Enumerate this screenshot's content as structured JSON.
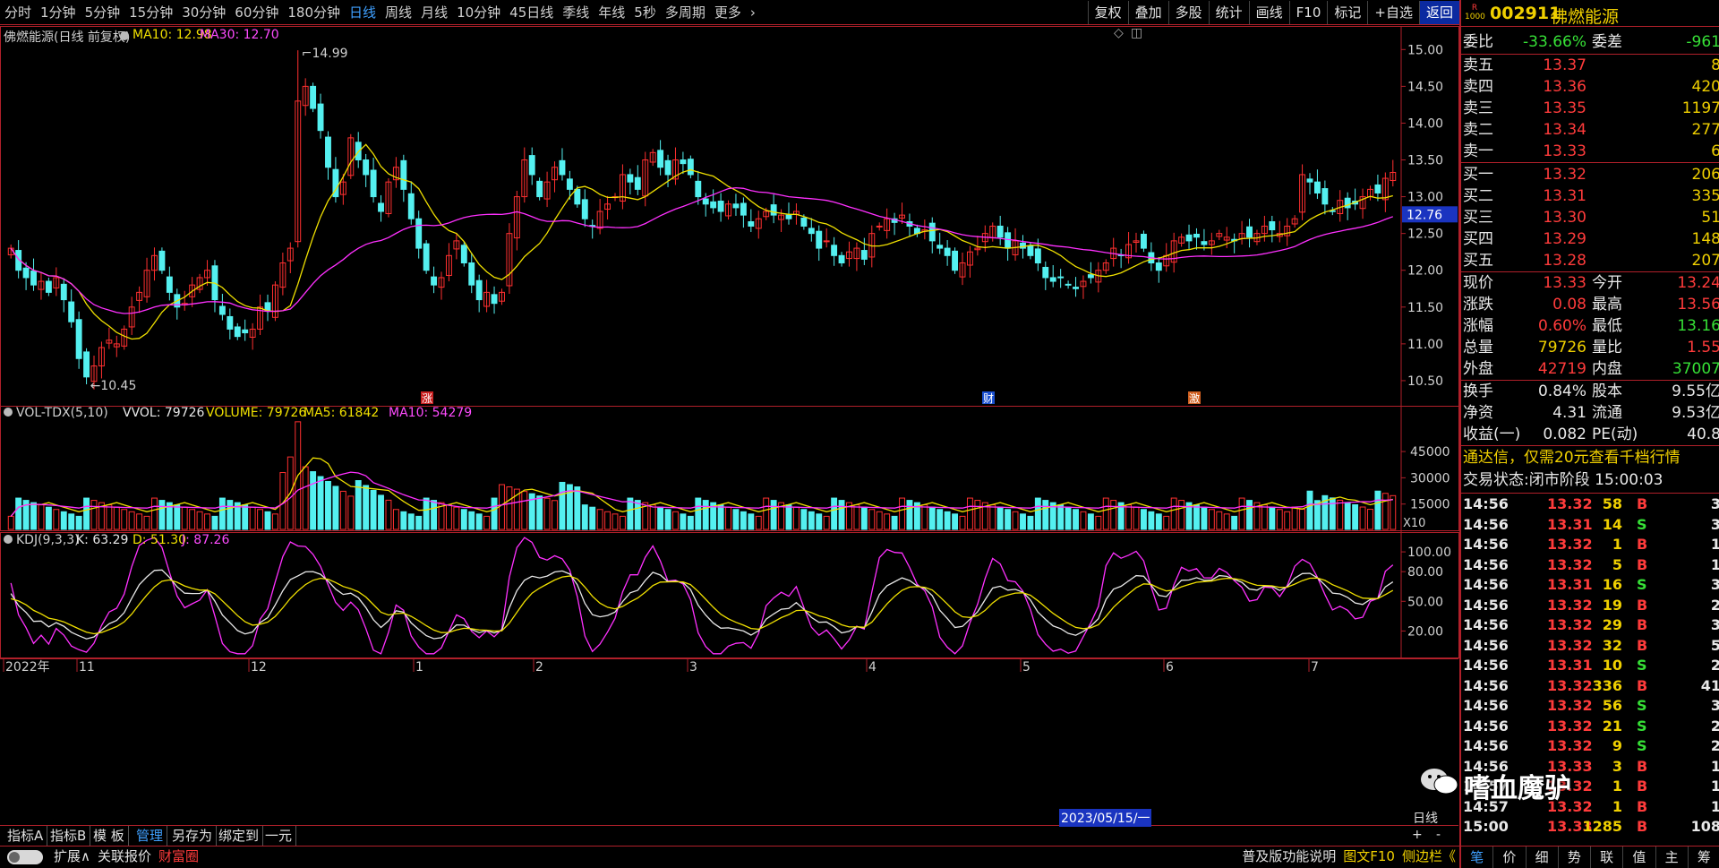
{
  "periods": [
    "分时",
    "1分钟",
    "5分钟",
    "15分钟",
    "30分钟",
    "60分钟",
    "180分钟",
    "日线",
    "周线",
    "月线",
    "10分钟",
    "45日线",
    "季线",
    "年线",
    "5秒",
    "多周期",
    "更多"
  ],
  "active_period": "日线",
  "tools": [
    "复权",
    "叠加",
    "多股",
    "统计",
    "画线",
    "F10",
    "标记",
    "+自选",
    "返回"
  ],
  "stock": {
    "code": "002911",
    "name": "佛燃能源",
    "badge_top": "R",
    "badge_bottom": "1000"
  },
  "main_panel": {
    "title": "佛燃能源(日线 前复权)",
    "ma10": "MA10: 12.98",
    "ma30": "MA30: 12.70",
    "high_mark": "14.99",
    "low_mark": "10.45",
    "cur_price_tag": "12.76",
    "yticks": [
      "15.00",
      "14.50",
      "14.00",
      "13.50",
      "13.00",
      "12.50",
      "12.00",
      "11.50",
      "11.00",
      "10.50"
    ],
    "events": [
      "涨",
      "财",
      "激"
    ]
  },
  "vol_panel": {
    "title": "VOL-TDX(5,10)",
    "vvol": "VVOL: 79726",
    "volume": "VOLUME: 79726",
    "ma5": "MA5: 61842",
    "ma10": "MA10: 54279",
    "yticks": [
      "45000",
      "30000",
      "15000"
    ],
    "unit": "X10"
  },
  "kdj_panel": {
    "title": "KDJ(9,3,3)",
    "k": "K: 63.29",
    "d": "D: 51.30",
    "j": "J: 87.26",
    "yticks": [
      "100.00",
      "80.00",
      "50.00",
      "20.00"
    ]
  },
  "xaxis": {
    "labels": [
      "2022年",
      "11",
      "12",
      "1",
      "2",
      "3",
      "4",
      "5",
      "6",
      "7"
    ],
    "cursor_date": "2023/05/15/一",
    "period_label": "日线",
    "plus": "+",
    "minus": "-"
  },
  "bottom_tabs": [
    "指标A",
    "指标B",
    "模 板",
    "管理",
    "另存为",
    "绑定到",
    "一元"
  ],
  "bottom_bar2": [
    "扩展∧",
    "关联报价",
    "财富圈"
  ],
  "bottom_right": [
    "普及版功能说明",
    "图文F10",
    "侧边栏《"
  ],
  "quote": {
    "weibi_label": "委比",
    "weibi": "-33.66%",
    "weicha_label": "委差",
    "weicha": "-961",
    "asks": [
      {
        "label": "卖五",
        "price": "13.37",
        "vol": "8"
      },
      {
        "label": "卖四",
        "price": "13.36",
        "vol": "420"
      },
      {
        "label": "卖三",
        "price": "13.35",
        "vol": "1197"
      },
      {
        "label": "卖二",
        "price": "13.34",
        "vol": "277"
      },
      {
        "label": "卖一",
        "price": "13.33",
        "vol": "6"
      }
    ],
    "bids": [
      {
        "label": "买一",
        "price": "13.32",
        "vol": "206"
      },
      {
        "label": "买二",
        "price": "13.31",
        "vol": "335"
      },
      {
        "label": "买三",
        "price": "13.30",
        "vol": "51"
      },
      {
        "label": "买四",
        "price": "13.29",
        "vol": "148"
      },
      {
        "label": "买五",
        "price": "13.28",
        "vol": "207"
      }
    ],
    "stats": [
      {
        "l1": "现价",
        "v1": "13.33",
        "c1": "red",
        "l2": "今开",
        "v2": "13.24",
        "c2": "red"
      },
      {
        "l1": "涨跌",
        "v1": "0.08",
        "c1": "red",
        "l2": "最高",
        "v2": "13.56",
        "c2": "red"
      },
      {
        "l1": "涨幅",
        "v1": "0.60%",
        "c1": "red",
        "l2": "最低",
        "v2": "13.16",
        "c2": "grn"
      },
      {
        "l1": "总量",
        "v1": "79726",
        "c1": "yel",
        "l2": "量比",
        "v2": "1.55",
        "c2": "red"
      },
      {
        "l1": "外盘",
        "v1": "42719",
        "c1": "red",
        "l2": "内盘",
        "v2": "37007",
        "c2": "grn"
      }
    ],
    "stats2": [
      {
        "l1": "换手",
        "v1": "0.84%",
        "l2": "股本",
        "v2": "9.55亿"
      },
      {
        "l1": "净资",
        "v1": "4.31",
        "l2": "流通",
        "v2": "9.53亿"
      },
      {
        "l1": "收益(一)",
        "v1": "0.082",
        "l2": "PE(动)",
        "v2": "40.8"
      }
    ],
    "ad": "通达信，仅需20元查看千档行情",
    "status": "交易状态:闭市阶段 15:00:03"
  },
  "ticks": [
    {
      "t": "14:56",
      "p": "13.32",
      "v": "58",
      "s": "B",
      "n": "3"
    },
    {
      "t": "14:56",
      "p": "13.31",
      "v": "14",
      "s": "S",
      "n": "3"
    },
    {
      "t": "14:56",
      "p": "13.32",
      "v": "1",
      "s": "B",
      "n": "1"
    },
    {
      "t": "14:56",
      "p": "13.32",
      "v": "5",
      "s": "B",
      "n": "1"
    },
    {
      "t": "14:56",
      "p": "13.31",
      "v": "16",
      "s": "S",
      "n": "3"
    },
    {
      "t": "14:56",
      "p": "13.32",
      "v": "19",
      "s": "B",
      "n": "2"
    },
    {
      "t": "14:56",
      "p": "13.32",
      "v": "29",
      "s": "B",
      "n": "3"
    },
    {
      "t": "14:56",
      "p": "13.32",
      "v": "32",
      "s": "B",
      "n": "5"
    },
    {
      "t": "14:56",
      "p": "13.31",
      "v": "10",
      "s": "S",
      "n": "2"
    },
    {
      "t": "14:56",
      "p": "13.32",
      "v": "336",
      "s": "B",
      "n": "41"
    },
    {
      "t": "14:56",
      "p": "13.32",
      "v": "56",
      "s": "S",
      "n": "3"
    },
    {
      "t": "14:56",
      "p": "13.32",
      "v": "21",
      "s": "S",
      "n": "2"
    },
    {
      "t": "14:56",
      "p": "13.32",
      "v": "9",
      "s": "S",
      "n": "2"
    },
    {
      "t": "14:56",
      "p": "13.33",
      "v": "3",
      "s": "B",
      "n": "1"
    },
    {
      "t": "14:57",
      "p": "13.32",
      "v": "1",
      "s": "B",
      "n": "1"
    },
    {
      "t": "14:57",
      "p": "13.32",
      "v": "1",
      "s": "B",
      "n": "1"
    },
    {
      "t": "15:00",
      "p": "13.33",
      "v": "1285",
      "s": "B",
      "n": "108"
    }
  ],
  "side_tabs": [
    "笔",
    "价",
    "细",
    "势",
    "联",
    "值",
    "主",
    "筹"
  ],
  "watermark": "嗜血魔驴"
}
